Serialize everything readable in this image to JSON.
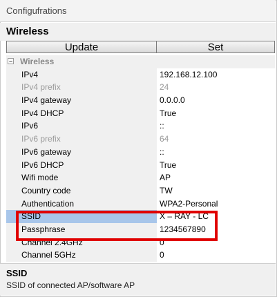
{
  "window": {
    "title": "Configufrations"
  },
  "section": {
    "title": "Wireless"
  },
  "toolbar": {
    "update_label": "Update",
    "set_label": "Set"
  },
  "group": {
    "toggle": "−",
    "label": "Wireless"
  },
  "rows": [
    {
      "label": "IPv4",
      "value": "192.168.12.100"
    },
    {
      "label": "IPv4 prefix",
      "value": "24"
    },
    {
      "label": "IPv4 gateway",
      "value": "0.0.0.0"
    },
    {
      "label": "IPv4 DHCP",
      "value": "True"
    },
    {
      "label": "IPv6",
      "value": "::"
    },
    {
      "label": "IPv6 prefix",
      "value": "64"
    },
    {
      "label": "IPv6 gateway",
      "value": "::"
    },
    {
      "label": "IPv6 DHCP",
      "value": "True"
    },
    {
      "label": "Wifi mode",
      "value": "AP"
    },
    {
      "label": "Country code",
      "value": "TW"
    },
    {
      "label": "Authentication",
      "value": "WPA2-Personal"
    },
    {
      "label": "SSID",
      "value": "X – RAY - LC"
    },
    {
      "label": "Passphrase",
      "value": "1234567890"
    },
    {
      "label": "Channel 2.4GHz",
      "value": "0"
    },
    {
      "label": "Channel 5GHz",
      "value": "0"
    }
  ],
  "description": {
    "title": "SSID",
    "text": "SSID of connected AP/software AP"
  },
  "colors": {
    "selection": "#a8c6ea",
    "highlight_box": "#e00000"
  }
}
